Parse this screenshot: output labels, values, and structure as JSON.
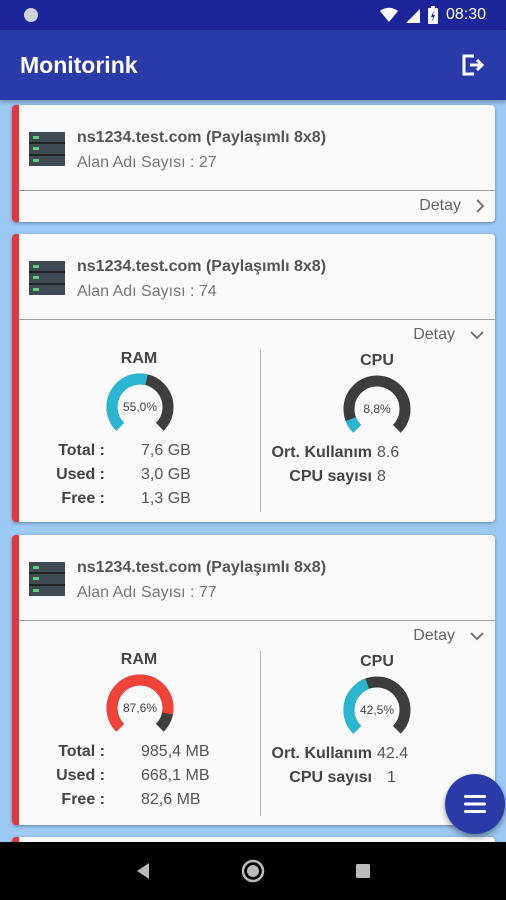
{
  "status_bar": {
    "time": "08:30"
  },
  "app": {
    "title": "Monitorink"
  },
  "servers": [
    {
      "hostname": "ns1234.test.com (Paylaşımlı 8x8)",
      "domain_count": "Alan Adı Sayısı : 27",
      "detail_label": "Detay",
      "expanded": false
    },
    {
      "hostname": "ns1234.test.com (Paylaşımlı 8x8)",
      "domain_count": "Alan Adı Sayısı : 74",
      "detail_label": "Detay",
      "expanded": true,
      "ram": {
        "title": "RAM",
        "percent_label": "55,0%",
        "percent": 55.0,
        "color": "#29b6d1",
        "total_label": "Total :",
        "total": "7,6 GB",
        "used_label": "Used :",
        "used": "3,0 GB",
        "free_label": "Free :",
        "free": "1,3 GB"
      },
      "cpu": {
        "title": "CPU",
        "percent_label": "8,8%",
        "percent": 8.8,
        "color": "#29b6d1",
        "avg_label": "Ort. Kullanım",
        "avg": "8.6",
        "count_label": "CPU sayısı",
        "count": "8"
      }
    },
    {
      "hostname": "ns1234.test.com (Paylaşımlı 8x8)",
      "domain_count": "Alan Adı Sayısı : 77",
      "detail_label": "Detay",
      "expanded": true,
      "ram": {
        "title": "RAM",
        "percent_label": "87,6%",
        "percent": 87.6,
        "color": "#f0433a",
        "total_label": "Total :",
        "total": "985,4 MB",
        "used_label": "Used :",
        "used": "668,1 MB",
        "free_label": "Free :",
        "free": "82,6 MB"
      },
      "cpu": {
        "title": "CPU",
        "percent_label": "42,5%",
        "percent": 42.5,
        "color": "#29b6d1",
        "avg_label": "Ort. Kullanım",
        "avg": "42.4",
        "count_label": "CPU sayısı",
        "count": "1"
      }
    }
  ],
  "colors": {
    "accent": "#e0393d",
    "appbar": "#2b3aa9",
    "gauge_track": "#3d3d3d"
  }
}
